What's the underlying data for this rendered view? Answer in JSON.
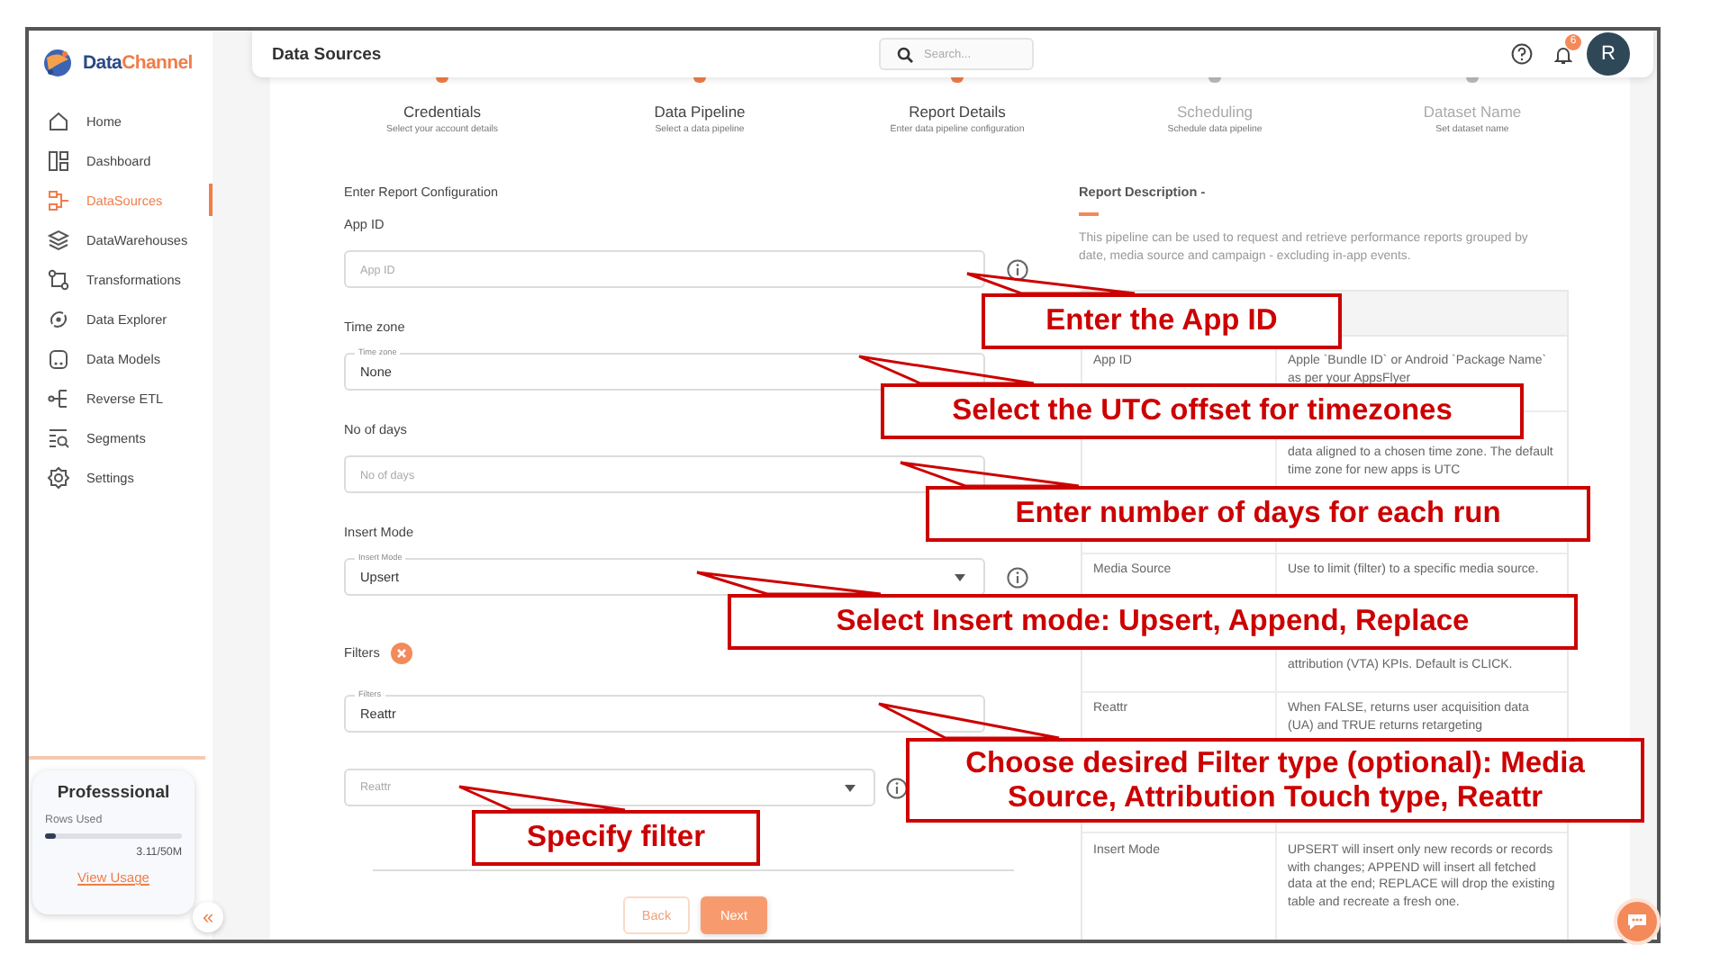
{
  "sidebar": {
    "logo": {
      "part_1": "Data",
      "part_2": "Channel"
    },
    "items": [
      {
        "label": "Home",
        "selected": false
      },
      {
        "label": "Dashboard",
        "selected": false
      },
      {
        "label": "DataSources",
        "selected": true
      },
      {
        "label": "DataWarehouses",
        "selected": false
      },
      {
        "label": "Transformations",
        "selected": false
      },
      {
        "label": "Data Explorer",
        "selected": false
      },
      {
        "label": "Data Models",
        "selected": false
      },
      {
        "label": "Reverse ETL",
        "selected": false
      },
      {
        "label": "Segments",
        "selected": false
      },
      {
        "label": "Settings",
        "selected": false
      }
    ],
    "plan": {
      "title": "Professsional",
      "rows_label": "Rows Used",
      "level": 0.08,
      "usage": "3.11/50M",
      "link": "View Usage"
    },
    "collapse": "«"
  },
  "header": {
    "title": "Data Sources",
    "search": {
      "placeholder": "Search..."
    },
    "notifications": "6",
    "avatar": "R"
  },
  "steps": [
    {
      "title": "Credentials",
      "subtitle": "Select your account details",
      "completed": true
    },
    {
      "title": "Data Pipeline",
      "subtitle": "Select a data pipeline",
      "completed": true
    },
    {
      "title": "Report Details",
      "subtitle": "Enter data pipeline configuration",
      "completed": true
    },
    {
      "title": "Scheduling",
      "subtitle": "Schedule data pipeline",
      "completed": false
    },
    {
      "title": "Dataset Name",
      "subtitle": "Set dataset name",
      "completed": false
    }
  ],
  "form": {
    "heading": "Enter Report Configuration",
    "groups": [
      {
        "label": "App ID",
        "removable": false,
        "fields": [
          {
            "kind": "input",
            "placeholder": "App ID",
            "info": true
          }
        ]
      },
      {
        "label": "Time zone",
        "removable": false,
        "fields": [
          {
            "kind": "input",
            "floating_label": "Time zone",
            "value": "None",
            "info": false
          }
        ]
      },
      {
        "label": "No of days",
        "removable": false,
        "fields": [
          {
            "kind": "input",
            "placeholder": "No of days",
            "info": false
          }
        ]
      },
      {
        "label": "Insert Mode",
        "removable": false,
        "fields": [
          {
            "kind": "select",
            "floating_label": "Insert Mode",
            "value": "Upsert",
            "info": true
          }
        ]
      },
      {
        "label": "Filters",
        "removable": true,
        "fields": [
          {
            "kind": "input",
            "floating_label": "Filters",
            "value": "Reattr",
            "info": false
          },
          {
            "kind": "select",
            "placeholder": "Reattr",
            "info": true
          }
        ]
      }
    ],
    "buttons": [
      {
        "label": "Back",
        "kind": "secondary"
      },
      {
        "label": "Next",
        "kind": "primary"
      }
    ]
  },
  "description": {
    "title": "Report Description -",
    "text": "This pipeline can be used to request and retrieve performance reports grouped by date, media source and campaign - excluding in-app events.",
    "table": {
      "rows": [
        {
          "column_1": "App ID",
          "column_2": "Apple `Bundle ID` or Android `Package Name` as per your AppsFlyer"
        },
        {
          "column_2": "data aligned to a chosen time zone. The default time zone for new apps is UTC"
        },
        {
          "column_1": "Media Source",
          "column_2": "Use to limit (filter) to a specific media source."
        },
        {
          "column_2": "attribution (VTA) KPIs. Default is CLICK."
        },
        {
          "column_1": "Reattr",
          "column_2": "When FALSE, returns user acquisition data (UA) and TRUE returns retargeting"
        },
        {
          "column_1": "Insert Mode",
          "column_2": "UPSERT will insert only new records or records with changes; APPEND will insert all fetched data at the end; REPLACE will drop the existing table and recreate a fresh one."
        }
      ]
    }
  },
  "callouts": [
    {
      "text": "Enter the App ID"
    },
    {
      "text": "Select the UTC offset for timezones"
    },
    {
      "text": "Enter number of days for each run"
    },
    {
      "text": "Select Insert mode: Upsert, Append, Replace"
    },
    {
      "text": "Choose desired Filter type (optional): Media Source, Attribution Touch type, Reattr"
    },
    {
      "text": "Specify filter"
    }
  ]
}
